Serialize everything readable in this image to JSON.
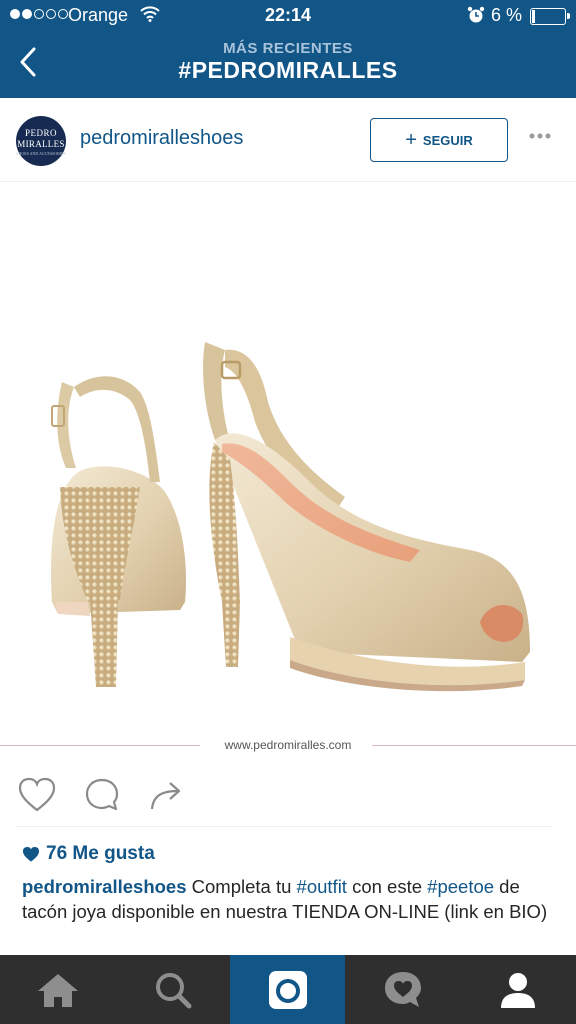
{
  "status_bar": {
    "carrier": "Orange",
    "time": "22:14",
    "battery": "6 %"
  },
  "nav": {
    "subtitle": "MÁS RECIENTES",
    "title": "#PEDROMIRALLES"
  },
  "post": {
    "avatar": {
      "line1": "PEDRO",
      "line2": "MIRALLES",
      "line3": "SHOES AND ACCESSORIES"
    },
    "username": "pedromiralleshoes",
    "follow_label": "SEGUIR",
    "watermark": "www.pedromiralles.com",
    "likes": "76 Me gusta",
    "caption": {
      "user": "pedromiralleshoes",
      "t1": " Completa tu ",
      "tag1": "#outfit",
      "t2": " con este ",
      "tag2": "#peetoe",
      "t3": " de tacón joya disponible en nuestra TIENDA ON-LINE (link en BIO)"
    }
  },
  "colors": {
    "brand_blue": "#125688",
    "tab_bar": "#2f2f2f"
  },
  "icons": [
    "back-chevron-icon",
    "more-options-icon",
    "heart-icon",
    "comment-icon",
    "share-icon",
    "home-icon",
    "search-icon",
    "camera-icon",
    "activity-icon",
    "profile-icon"
  ]
}
